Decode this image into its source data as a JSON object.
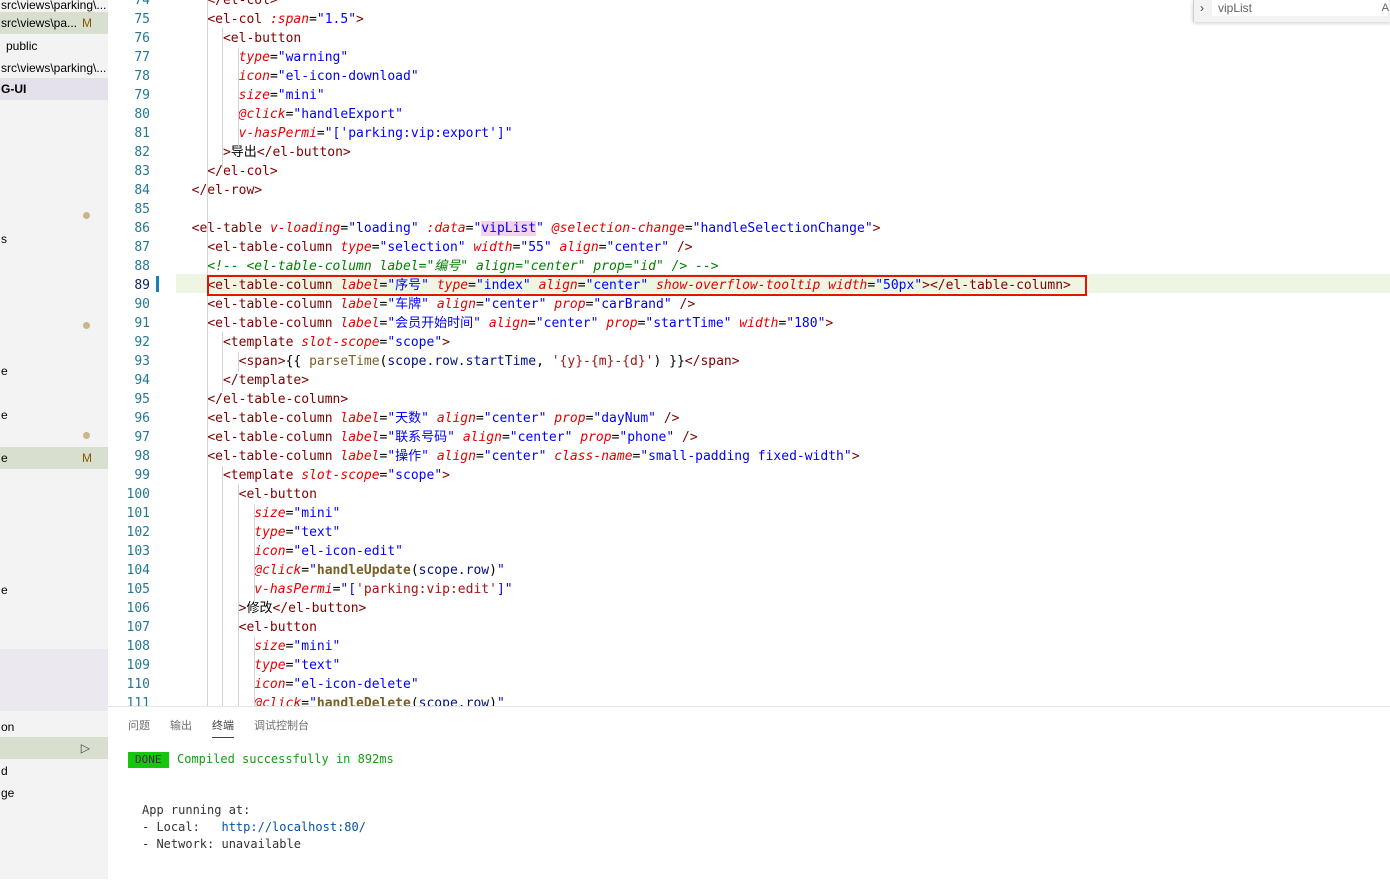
{
  "sidebar": {
    "items": [
      {
        "label": "src\\views\\parking\\...",
        "badge": ""
      },
      {
        "label": "src\\views\\pa...",
        "badge": "M"
      },
      {
        "label": "public",
        "badge": ""
      },
      {
        "label": "src\\views\\parking\\...",
        "badge": ""
      },
      {
        "label": "G-UI",
        "badge": ""
      }
    ],
    "fragments": [
      "s",
      "e",
      "e",
      "e",
      "M",
      "e",
      "on",
      "d",
      "ge"
    ]
  },
  "editor": {
    "lines": [
      {
        "n": "74",
        "html": "    <span class=\"p\">&lt;/el-col&gt;</span>"
      },
      {
        "n": "75",
        "html": "    <span class=\"p\">&lt;</span><span class=\"t\">el-col</span> <span class=\"a it\">:span</span>=<span class=\"v\">\"1.5\"</span><span class=\"p\">&gt;</span>"
      },
      {
        "n": "76",
        "html": "      <span class=\"p\">&lt;</span><span class=\"t\">el-button</span>"
      },
      {
        "n": "77",
        "html": "        <span class=\"a it\">type</span>=<span class=\"v\">\"warning\"</span>"
      },
      {
        "n": "78",
        "html": "        <span class=\"a it\">icon</span>=<span class=\"v\">\"el-icon-download\"</span>"
      },
      {
        "n": "79",
        "html": "        <span class=\"a it\">size</span>=<span class=\"v\">\"mini\"</span>"
      },
      {
        "n": "80",
        "html": "        <span class=\"a it\">@click</span>=<span class=\"v\">\"handleExport\"</span>"
      },
      {
        "n": "81",
        "html": "        <span class=\"a it\">v-hasPermi</span>=<span class=\"v\">\"['parking:vip:export']\"</span>"
      },
      {
        "n": "82",
        "html": "      <span class=\"p\">&gt;</span><span class=\"txt\">导出</span><span class=\"p\">&lt;/el-button&gt;</span>"
      },
      {
        "n": "83",
        "html": "    <span class=\"p\">&lt;/el-col&gt;</span>"
      },
      {
        "n": "84",
        "html": "  <span class=\"p\">&lt;/el-row&gt;</span>"
      },
      {
        "n": "85",
        "html": ""
      },
      {
        "n": "86",
        "html": "  <span class=\"p\">&lt;</span><span class=\"t\">el-table</span> <span class=\"a it\">v-loading</span>=<span class=\"v\">\"loading\"</span> <span class=\"a it\">:data</span>=<span class=\"v\">\"</span><span class=\"v\" style=\"background:#f5d2e8\">vipList</span><span class=\"v\">\"</span> <span class=\"a it\">@selection-change</span>=<span class=\"v\">\"handleSelectionChange\"</span><span class=\"p\">&gt;</span>"
      },
      {
        "n": "87",
        "html": "    <span class=\"p\">&lt;</span><span class=\"t\">el-table-column</span> <span class=\"a it\">type</span>=<span class=\"v\">\"selection\"</span> <span class=\"a it\">width</span>=<span class=\"v\">\"55\"</span> <span class=\"a it\">align</span>=<span class=\"v\">\"center\"</span> <span class=\"p\">/&gt;</span>"
      },
      {
        "n": "88",
        "html": "    <span class=\"cm\">&lt;!-- &lt;el-table-column label=\"编号\" align=\"center\" prop=\"id\" /&gt; --&gt;</span>"
      },
      {
        "n": "89",
        "html": "    <span class=\"p\">&lt;</span><span class=\"t\">el-table-column</span> <span class=\"a it\">label</span>=<span class=\"v\">\"序号\"</span> <span class=\"a it\">type</span>=<span class=\"v\">\"index\"</span> <span class=\"a it\">align</span>=<span class=\"v\">\"center\"</span> <span class=\"a it\">show-overflow-tooltip</span> <span class=\"a it\">width</span>=<span class=\"v\">\"50px\"</span><span class=\"p\">&gt;&lt;/</span><span class=\"t\">el-table-column</span><span class=\"p\">&gt;</span>"
      },
      {
        "n": "90",
        "html": "    <span class=\"p\">&lt;</span><span class=\"t\">el-table-column</span> <span class=\"a it\">label</span>=<span class=\"v\">\"车牌\"</span> <span class=\"a it\">align</span>=<span class=\"v\">\"center\"</span> <span class=\"a it\">prop</span>=<span class=\"v\">\"carBrand\"</span> <span class=\"p\">/&gt;</span>"
      },
      {
        "n": "91",
        "html": "    <span class=\"p\">&lt;</span><span class=\"t\">el-table-column</span> <span class=\"a it\">label</span>=<span class=\"v\">\"会员开始时间\"</span> <span class=\"a it\">align</span>=<span class=\"v\">\"center\"</span> <span class=\"a it\">prop</span>=<span class=\"v\">\"startTime\"</span> <span class=\"a it\">width</span>=<span class=\"v\">\"180\"</span><span class=\"p\">&gt;</span>"
      },
      {
        "n": "92",
        "html": "      <span class=\"p\">&lt;</span><span class=\"t\">template</span> <span class=\"a it\">slot-scope</span>=<span class=\"v\">\"scope\"</span><span class=\"p\">&gt;</span>"
      },
      {
        "n": "93",
        "html": "        <span class=\"p\">&lt;</span><span class=\"t\">span</span><span class=\"p\">&gt;</span><span class=\"txt\">{{ </span><span class=\"fn\" style=\"color:#795e26;font-weight:normal\">parseTime</span><span class=\"txt\">(</span><span class=\"v\" style=\"color:#001080\">scope.row.startTime</span><span class=\"txt\">, </span><span class=\"v2\">'{y}-{m}-{d}'</span><span class=\"txt\">) }}</span><span class=\"p\">&lt;/span&gt;</span>"
      },
      {
        "n": "94",
        "html": "      <span class=\"p\">&lt;/template&gt;</span>"
      },
      {
        "n": "95",
        "html": "    <span class=\"p\">&lt;/el-table-column&gt;</span>"
      },
      {
        "n": "96",
        "html": "    <span class=\"p\">&lt;</span><span class=\"t\">el-table-column</span> <span class=\"a it\">label</span>=<span class=\"v\">\"天数\"</span> <span class=\"a it\">align</span>=<span class=\"v\">\"center\"</span> <span class=\"a it\">prop</span>=<span class=\"v\">\"dayNum\"</span> <span class=\"p\">/&gt;</span>"
      },
      {
        "n": "97",
        "html": "    <span class=\"p\">&lt;</span><span class=\"t\">el-table-column</span> <span class=\"a it\">label</span>=<span class=\"v\">\"联系号码\"</span> <span class=\"a it\">align</span>=<span class=\"v\">\"center\"</span> <span class=\"a it\">prop</span>=<span class=\"v\">\"phone\"</span> <span class=\"p\">/&gt;</span>"
      },
      {
        "n": "98",
        "html": "    <span class=\"p\">&lt;</span><span class=\"t\">el-table-column</span> <span class=\"a it\">label</span>=<span class=\"v\">\"操作\"</span> <span class=\"a it\">align</span>=<span class=\"v\">\"center\"</span> <span class=\"a it\">class-name</span>=<span class=\"v\">\"small-padding fixed-width\"</span><span class=\"p\">&gt;</span>"
      },
      {
        "n": "99",
        "html": "      <span class=\"p\">&lt;</span><span class=\"t\">template</span> <span class=\"a it\">slot-scope</span>=<span class=\"v\">\"scope\"</span><span class=\"p\">&gt;</span>"
      },
      {
        "n": "100",
        "html": "        <span class=\"p\">&lt;</span><span class=\"t\">el-button</span>"
      },
      {
        "n": "101",
        "html": "          <span class=\"a it\">size</span>=<span class=\"v\">\"mini\"</span>"
      },
      {
        "n": "102",
        "html": "          <span class=\"a it\">type</span>=<span class=\"v\">\"text\"</span>"
      },
      {
        "n": "103",
        "html": "          <span class=\"a it\">icon</span>=<span class=\"v\">\"el-icon-edit\"</span>"
      },
      {
        "n": "104",
        "html": "          <span class=\"a it\">@click</span>=<span class=\"v\">\"</span><span class=\"fn\">handleUpdate</span><span class=\"txt\">(</span><span class=\"v\" style=\"color:#001080\">scope.row</span><span class=\"txt\">)</span><span class=\"v\">\"</span>"
      },
      {
        "n": "105",
        "html": "          <span class=\"a it\">v-hasPermi</span>=<span class=\"v\">\"[</span><span class=\"v2\">'parking:vip:edit'</span><span class=\"v\">]\"</span>"
      },
      {
        "n": "106",
        "html": "        <span class=\"p\">&gt;</span><span class=\"txt\">修改</span><span class=\"p\">&lt;/el-button&gt;</span>"
      },
      {
        "n": "107",
        "html": "        <span class=\"p\">&lt;</span><span class=\"t\">el-button</span>"
      },
      {
        "n": "108",
        "html": "          <span class=\"a it\">size</span>=<span class=\"v\">\"mini\"</span>"
      },
      {
        "n": "109",
        "html": "          <span class=\"a it\">type</span>=<span class=\"v\">\"text\"</span>"
      },
      {
        "n": "110",
        "html": "          <span class=\"a it\">icon</span>=<span class=\"v\">\"el-icon-delete\"</span>"
      },
      {
        "n": "111",
        "html": "          <span class=\"a it\">@click</span>=<span class=\"v\">\"</span><span class=\"fn\">handleDelete</span><span class=\"txt\">(</span><span class=\"v\" style=\"color:#001080\">scope.row</span><span class=\"txt\">)</span><span class=\"v\">\"</span>"
      }
    ],
    "highlighted_line": "89"
  },
  "find_widget": {
    "value": "vipList",
    "option": "A"
  },
  "panel": {
    "tabs": [
      "问题",
      "输出",
      "终端",
      "调试控制台"
    ],
    "active_tab": "终端",
    "terminal": {
      "badge": "DONE",
      "compiled": "Compiled successfully in 892ms",
      "running": "App running at:",
      "local_label": "- Local:   ",
      "local_url": "http://localhost:80/",
      "network": "- Network: unavailable"
    }
  },
  "colors": {
    "accent_green": "#16c60c",
    "highlight_red": "#e51400",
    "line_number": "#237893"
  }
}
